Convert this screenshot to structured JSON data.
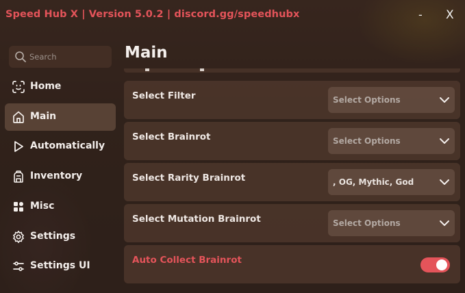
{
  "window": {
    "title": "Speed Hub X | Version 5.0.2 | discord.gg/speedhubx",
    "minimize_label": "-",
    "close_label": "X"
  },
  "search": {
    "placeholder": "Search"
  },
  "sidebar": {
    "items": [
      {
        "label": "Home",
        "icon": "scan-face-icon"
      },
      {
        "label": "Main",
        "icon": "home-icon",
        "active": true
      },
      {
        "label": "Automatically",
        "icon": "play-icon"
      },
      {
        "label": "Inventory",
        "icon": "backpack-icon"
      },
      {
        "label": "Misc",
        "icon": "grid-icon"
      },
      {
        "label": "Settings",
        "icon": "gear-icon"
      },
      {
        "label": "Settings UI",
        "icon": "sliders-icon"
      }
    ]
  },
  "main": {
    "title": "Main",
    "rows": [
      {
        "label": "Select Filter",
        "type": "dropdown",
        "value": "Select Options"
      },
      {
        "label": "Select Brainrot",
        "type": "dropdown",
        "value": "Select Options"
      },
      {
        "label": "Select Rarity Brainrot",
        "type": "dropdown",
        "value": ", OG, Mythic, God"
      },
      {
        "label": "Select Mutation Brainrot",
        "type": "dropdown",
        "value": "Select Options"
      },
      {
        "label": "Auto Collect Brainrot",
        "type": "toggle",
        "enabled": true
      }
    ]
  },
  "colors": {
    "accent": "#e4545a",
    "panel": "#4e372c",
    "text": "#f1ece8"
  }
}
